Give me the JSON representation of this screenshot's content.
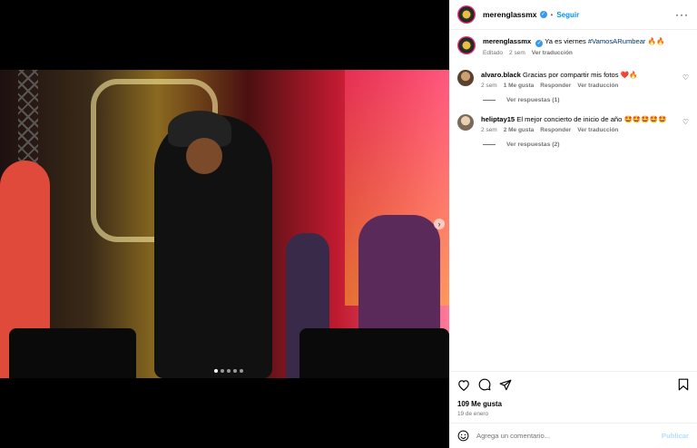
{
  "post": {
    "username": "merenglassmx",
    "follow_label": "Seguir",
    "separator": "•",
    "caption": "Ya es viernes",
    "hashtag": "#VamosARumbear",
    "caption_emoji": "🔥🔥",
    "edited_label": "Editado",
    "time": "2 sem",
    "translate_label": "Ver traducción",
    "likes": "109 Me gusta",
    "date": "19 de enero",
    "carousel_count": 5,
    "carousel_active": 0
  },
  "comments": [
    {
      "username": "alvaro.black",
      "text": "Gracias por compartir mis fotos ❤️🔥",
      "time": "2 sem",
      "likes": "1 Me gusta",
      "reply_label": "Responder",
      "translate_label": "Ver traducción",
      "replies_label": "Ver respuestas (1)"
    },
    {
      "username": "heliptay15",
      "text": "El mejor concierto de inicio de año 🤩🤩🤩🤩🤩",
      "time": "2 sem",
      "likes": "2 Me gusta",
      "reply_label": "Responder",
      "translate_label": "Ver traducción",
      "replies_label": "Ver respuestas (2)"
    }
  ],
  "composer": {
    "placeholder": "Agrega un comentario...",
    "publish_label": "Publicar"
  },
  "icons": {
    "like": "heart-icon",
    "comment": "comment-icon",
    "share": "share-icon",
    "save": "bookmark-icon",
    "more": "more-options-icon",
    "emoji": "emoji-icon",
    "verified": "verified-badge-icon"
  },
  "colors": {
    "accent": "#0095f6",
    "verified": "#3897f0",
    "muted": "#737373",
    "publish_disabled": "#b2dffc"
  }
}
